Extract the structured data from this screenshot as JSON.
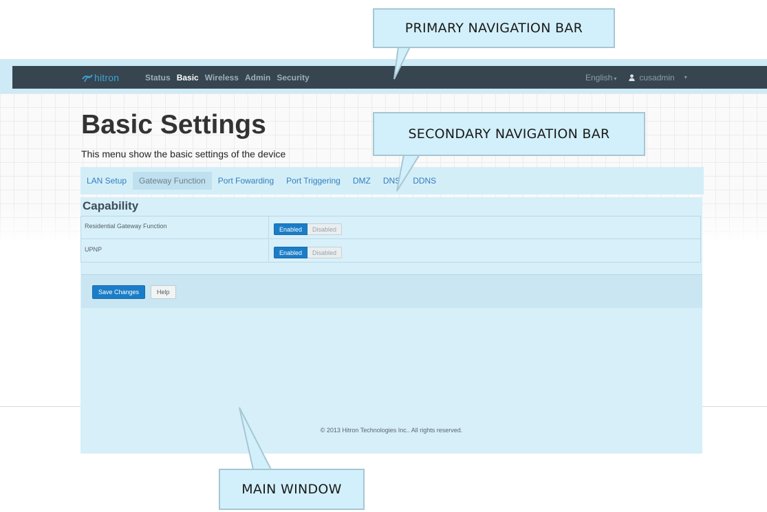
{
  "navbar": {
    "brand": "hitron",
    "items": [
      {
        "label": "Status",
        "active": false
      },
      {
        "label": "Basic",
        "active": true
      },
      {
        "label": "Wireless",
        "active": false
      },
      {
        "label": "Admin",
        "active": false
      },
      {
        "label": "Security",
        "active": false
      }
    ],
    "language": "English",
    "user": "cusadmin"
  },
  "page": {
    "title": "Basic Settings",
    "subtitle": "This menu show the basic settings of the device"
  },
  "subnav": {
    "tabs": [
      {
        "label": "LAN Setup",
        "active": false
      },
      {
        "label": "Gateway Function",
        "active": true
      },
      {
        "label": "Port Fowarding",
        "active": false
      },
      {
        "label": "Port Triggering",
        "active": false
      },
      {
        "label": "DMZ",
        "active": false
      },
      {
        "label": "DNS",
        "active": false
      },
      {
        "label": "DDNS",
        "active": false
      }
    ]
  },
  "capability": {
    "title": "Capability",
    "rows": [
      {
        "label": "Residential Gateway Function",
        "enabled_label": "Enabled",
        "disabled_label": "Disabled",
        "value": "Enabled"
      },
      {
        "label": "UPNP",
        "enabled_label": "Enabled",
        "disabled_label": "Disabled",
        "value": "Enabled"
      }
    ]
  },
  "actions": {
    "save_label": "Save Changes",
    "help_label": "Help"
  },
  "footer": {
    "copyright": "© 2013 Hitron Technologies Inc.. All rights reserved."
  },
  "callouts": {
    "primary": "PRIMARY NAVIGATION BAR",
    "secondary": "SECONDARY NAVIGATION BAR",
    "main": "MAIN WINDOW"
  },
  "colors": {
    "navbar_bg": "#36454f",
    "accent_blue": "#1b7dc7",
    "highlight": "#d2f0fb",
    "brand": "#3fa3d9"
  }
}
